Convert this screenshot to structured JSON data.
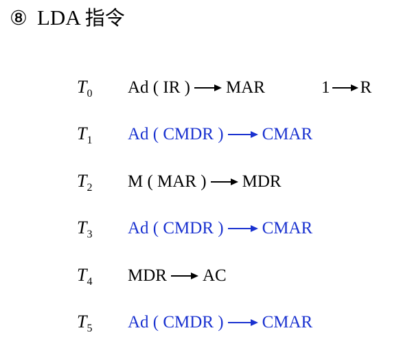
{
  "title": {
    "number": "⑧",
    "text": "LDA",
    "cjk": "指令"
  },
  "colors": {
    "black": "#000000",
    "blue": "#1a32d0"
  },
  "steps": [
    {
      "t": "T",
      "sub": "0",
      "src": "Ad ( IR )",
      "dst": "MAR",
      "color": "black",
      "extra": {
        "src": "1",
        "dst": "R"
      }
    },
    {
      "t": "T",
      "sub": "1",
      "src": "Ad ( CMDR )",
      "dst": "CMAR",
      "color": "blue"
    },
    {
      "t": "T",
      "sub": "2",
      "src": "M ( MAR )",
      "dst": "MDR",
      "color": "black"
    },
    {
      "t": "T",
      "sub": "3",
      "src": "Ad ( CMDR )",
      "dst": "CMAR",
      "color": "blue"
    },
    {
      "t": "T",
      "sub": "4",
      "src": "MDR",
      "dst": "AC",
      "color": "black"
    },
    {
      "t": "T",
      "sub": "5",
      "src": "Ad ( CMDR )",
      "dst": "CMAR",
      "color": "blue"
    }
  ]
}
